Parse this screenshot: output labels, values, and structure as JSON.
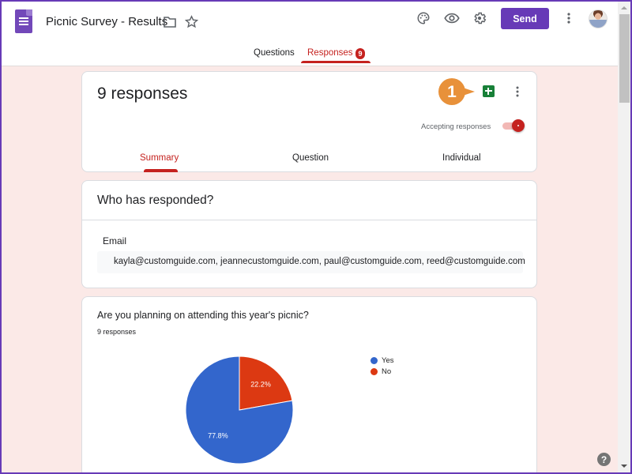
{
  "header": {
    "doc_title": "Picnic Survey - Results",
    "send_label": "Send",
    "icons": [
      "forms-logo-icon",
      "folder-icon",
      "star-icon",
      "palette-icon",
      "eye-icon",
      "gear-icon",
      "more-vert-icon",
      "avatar"
    ]
  },
  "tabs": {
    "questions": "Questions",
    "responses": "Responses",
    "responses_badge": "9",
    "active": "Responses"
  },
  "summary_card": {
    "response_count": "9 responses",
    "accepting_label": "Accepting responses",
    "accepting_on": true,
    "callout_number": "1",
    "tabs": [
      "Summary",
      "Question",
      "Individual"
    ],
    "active_tab": "Summary"
  },
  "who_card": {
    "title": "Who has responded?",
    "email_label": "Email",
    "emails": "kayla@customguide.com, jeannecustomguide.com, paul@customguide.com, reed@customguide.com"
  },
  "question_card": {
    "title": "Are you planning on attending this year's picnic?",
    "response_count": "9 responses"
  },
  "colors": {
    "accent": "#673ab7",
    "responses_red": "#c5221f",
    "yes_blue": "#3366cc",
    "no_red": "#dc3912",
    "callout_orange": "#e8913a",
    "sheets_green": "#188038"
  },
  "chart_data": {
    "type": "pie",
    "title": "Are you planning on attending this year's picnic?",
    "subtitle": "9 responses",
    "categories": [
      "Yes",
      "No"
    ],
    "values": [
      77.8,
      22.2
    ],
    "labels": [
      "77.8%",
      "22.2%"
    ],
    "colors": [
      "#3366cc",
      "#dc3912"
    ],
    "legend": "right"
  },
  "help_label": "?"
}
